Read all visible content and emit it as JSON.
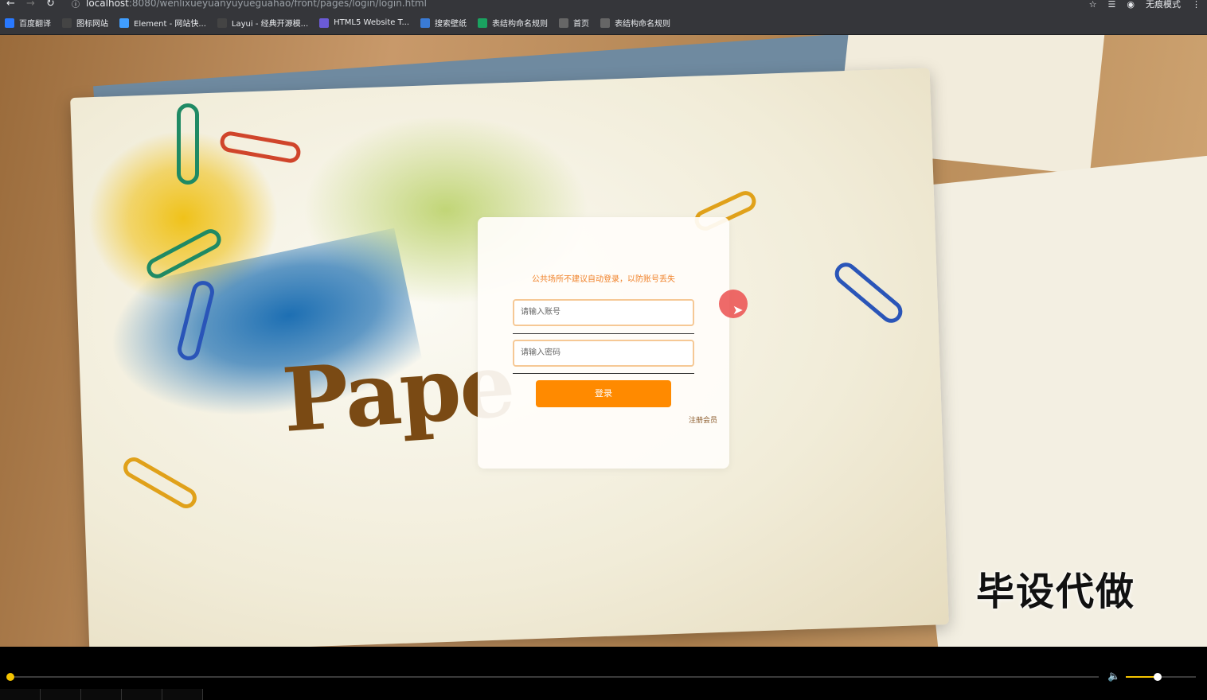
{
  "browser": {
    "url_host": "localhost",
    "url_path": ":8080/wenlixueyuanyuyueguahao/front/pages/login/login.html",
    "incognito_label": "无痕模式",
    "bookmarks": [
      {
        "label": "百度翻译",
        "icon": "translate-icon",
        "color": "#2979ff"
      },
      {
        "label": "图标网站",
        "icon": "flag-icon",
        "color": "#444444"
      },
      {
        "label": "Element - 网站快...",
        "icon": "element-icon",
        "color": "#409eff"
      },
      {
        "label": "Layui - 经典开源模...",
        "icon": "layui-icon",
        "color": "#444444"
      },
      {
        "label": "HTML5 Website T...",
        "icon": "html5-icon",
        "color": "#6b5bd6"
      },
      {
        "label": "搜索壁纸",
        "icon": "wallpaper-icon",
        "color": "#3a7bd5"
      },
      {
        "label": "表结构命名规则",
        "icon": "sheet-icon",
        "color": "#1aa260"
      },
      {
        "label": "首页",
        "icon": "globe-icon",
        "color": "#666666"
      },
      {
        "label": "表结构命名规则",
        "icon": "globe-icon",
        "color": "#666666"
      }
    ]
  },
  "login": {
    "notice": "公共场所不建议自动登录，以防账号丢失",
    "username_placeholder": "请输入账号",
    "password_placeholder": "请输入密码",
    "login_button": "登录",
    "register_link": "注册会员"
  },
  "background": {
    "paper_word": "Pape",
    "watermark": "毕设代做"
  },
  "player": {
    "progress": 0.0,
    "volume": 0.45
  },
  "colors": {
    "accent": "#ff8a00",
    "notice": "#f0822a",
    "input_border": "#f6c895"
  }
}
